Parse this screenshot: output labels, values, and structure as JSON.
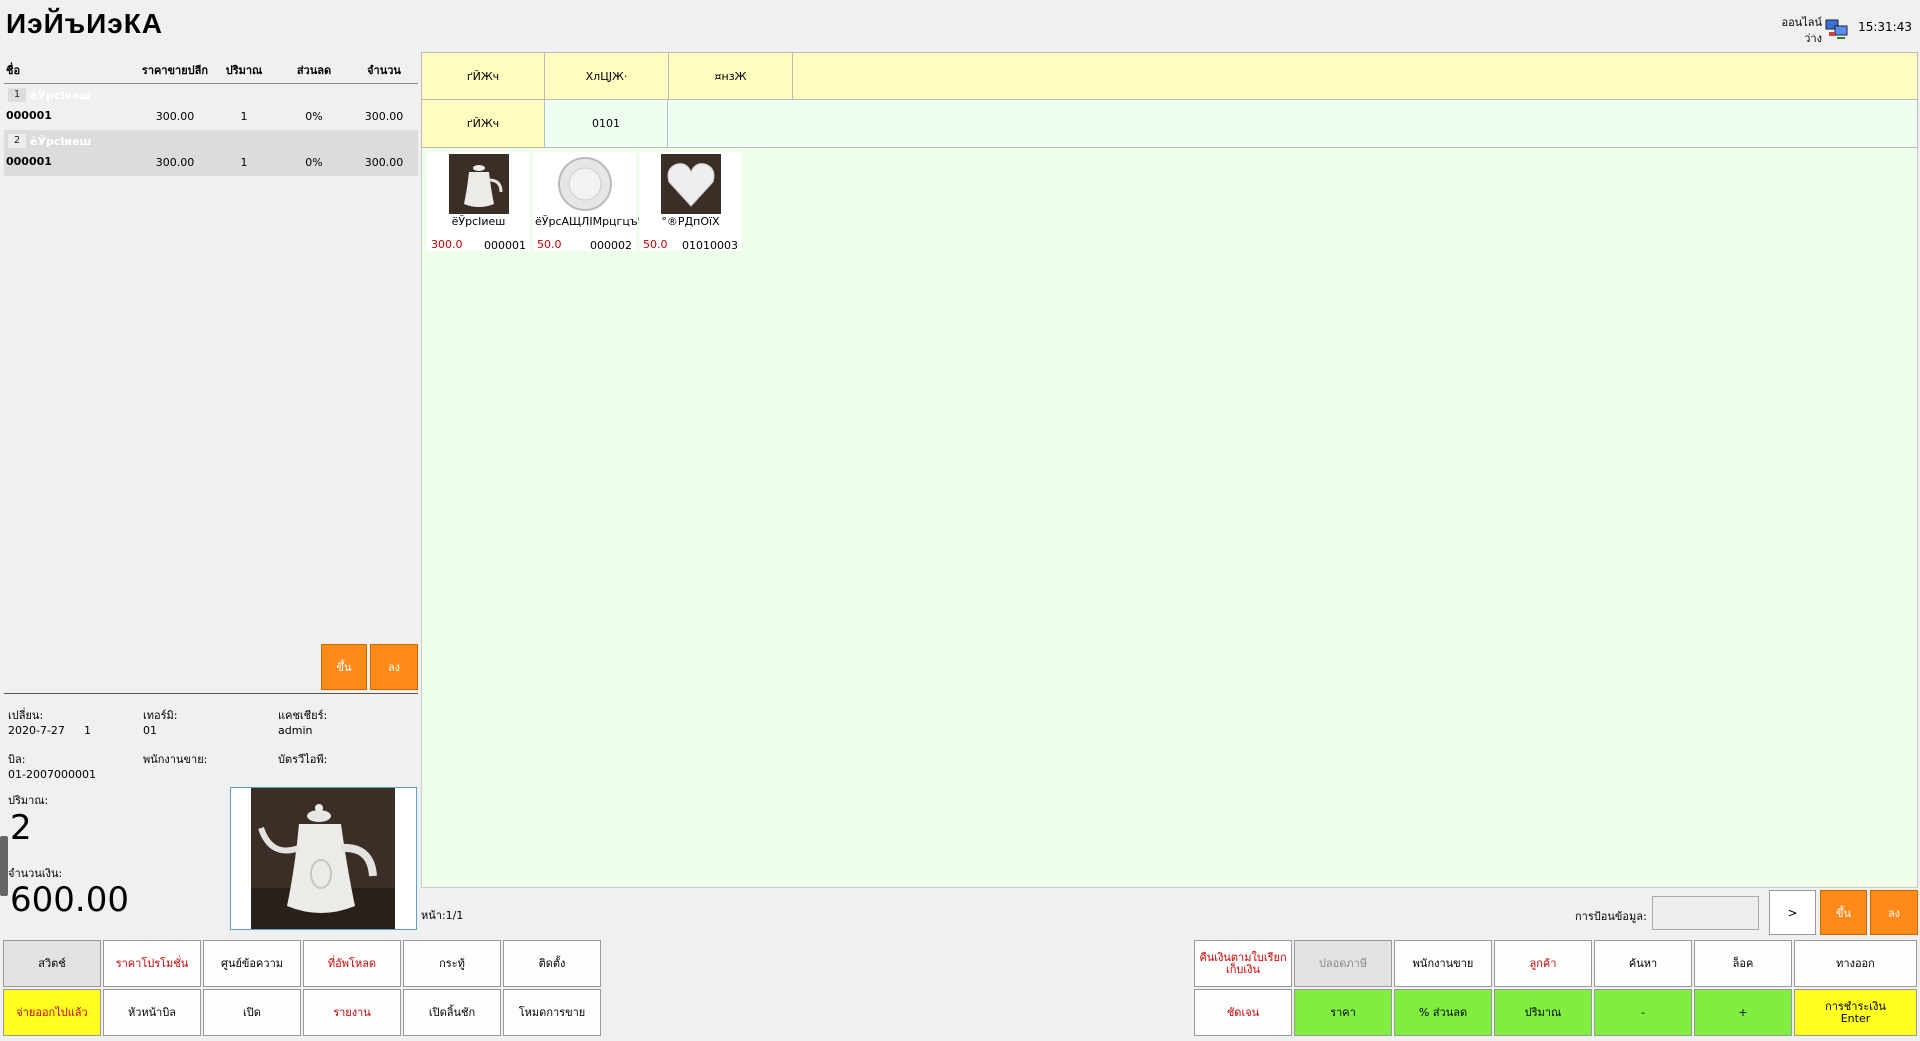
{
  "header": {
    "title": "ИэЙъИэКА",
    "status_online": "ออนไลน์",
    "status_idle": "ว่าง",
    "clock": "15:31:43"
  },
  "order_table": {
    "columns": [
      "ชื่อ",
      "ราคาขายปลีก",
      "ปริมาณ",
      "ส่วนลด",
      "จำนวน"
    ],
    "rows": [
      {
        "index": "1",
        "name": "ёЎрсІиеш",
        "code": "000001",
        "price": "300.00",
        "qty": "1",
        "discount": "0%",
        "total": "300.00"
      },
      {
        "index": "2",
        "name": "ёЎрсІиеш",
        "code": "000001",
        "price": "300.00",
        "qty": "1",
        "discount": "0%",
        "total": "300.00"
      }
    ],
    "up_label": "ขึ้น",
    "down_label": "ลง"
  },
  "info": {
    "shift_label": "เปลี่ยน:",
    "shift_date": "2020-7-27",
    "shift_no": "1",
    "terminal_label": "เทอร์มิ:",
    "terminal_val": "01",
    "cashier_label": "แคชเชียร์:",
    "cashier_val": "admin",
    "bill_label": "บิล:",
    "bill_val": "01-2007000001",
    "salesperson_label": "พนักงานขาย:",
    "vip_label": "บัตรวีไอพี:",
    "qty_label": "ปริมาณ:",
    "qty_val": "2",
    "amount_label": "จำนวนเงิน:",
    "amount_val": "600.00"
  },
  "categories": {
    "header": [
      "ґЙЖч",
      "ХлЦЈЖ·",
      "¤нзЖ"
    ],
    "sub_label": "ґЙЖч",
    "sub_code": "0101"
  },
  "products": [
    {
      "name": "ёЎрсІиеш",
      "price": "300.0",
      "code": "000001"
    },
    {
      "name": "ёЎрсАЩЛІМрцгцъЧУ",
      "price": "50.0",
      "code": "000002"
    },
    {
      "name": "°®РДпОїХ",
      "price": "50.0",
      "code": "01010003"
    }
  ],
  "pager": {
    "page_label": "หน้า:1/1",
    "input_label": "การป้อนข้อมูล:",
    "next_label": ">",
    "up_label": "ขึ้น",
    "down_label": "ลง"
  },
  "left_buttons_row1": [
    "สวิตช์",
    "ราคาโปรโมชั่น",
    "ศูนย์ข้อความ",
    "ที่อัพโหลด",
    "กระทู้",
    "ติดตั้ง"
  ],
  "left_buttons_row2": [
    "จ่ายออกไปแล้ว",
    "หัวหน้าบิล",
    "เปิด",
    "รายงาน",
    "เปิดลิ้นชัก",
    "โหมดการขาย"
  ],
  "right_buttons_row1": [
    "คืนเงินตามใบเรียกเก็บเงิน",
    "ปลอดภาษี",
    "พนักงานขาย",
    "ลูกค้า",
    "ค้นหา",
    "ล็อค",
    "ทางออก"
  ],
  "right_buttons_row2": [
    "ชัดเจน",
    "ราคา",
    "% ส่วนลด",
    "ปริมาณ",
    "-",
    "+",
    "การชำระเงิน\nEnter"
  ],
  "colors": {
    "accent_orange": "#ff8a1a",
    "category_yellow": "#fffcc0",
    "product_bg": "#eefee9",
    "button_green": "#80ee40",
    "button_yellow": "#ffff22",
    "alert_red": "#d00000"
  }
}
